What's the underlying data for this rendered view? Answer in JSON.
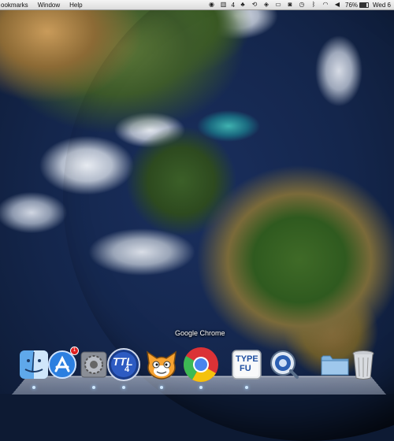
{
  "menubar": {
    "items": [
      "ookmarks",
      "Window",
      "Help"
    ],
    "status": {
      "screen_count": "4",
      "battery_percent": "76%",
      "battery_level": 0.76,
      "clock": "Wed 6"
    }
  },
  "dock": {
    "tooltip": "Google Chrome",
    "items": [
      {
        "name": "Finder",
        "running": true
      },
      {
        "name": "App Store",
        "badge": "1",
        "running": false
      },
      {
        "name": "System Preferences",
        "running": true
      },
      {
        "name": "TTL4",
        "text": "TTL",
        "subtext": "4",
        "running": true
      },
      {
        "name": "Scratch",
        "running": true
      },
      {
        "name": "Google Chrome",
        "running": true
      },
      {
        "name": "Type Fu",
        "text_line1": "TYPE",
        "text_line2": "FU",
        "running": true
      },
      {
        "name": "QuickTime Player",
        "running": false
      },
      {
        "name": "Downloads",
        "running": false
      },
      {
        "name": "Trash",
        "running": false
      }
    ]
  },
  "colors": {
    "menubar": "#e8e8e8",
    "chrome_red": "#db3236",
    "chrome_green": "#3cba54",
    "chrome_yellow": "#f4c20d",
    "chrome_blue": "#4885ed"
  }
}
